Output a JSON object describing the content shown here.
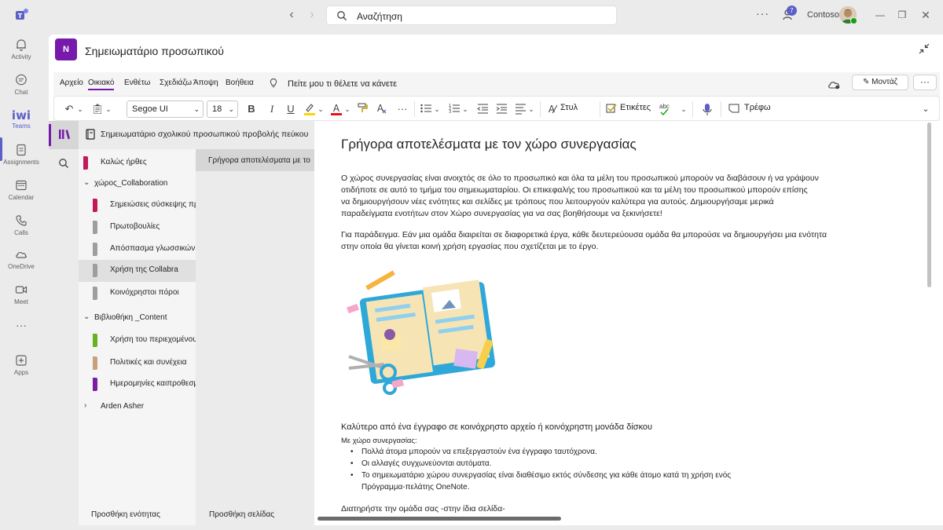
{
  "titlebar": {
    "search_placeholder": "Αναζήτηση",
    "more": "···",
    "notification_count": "7",
    "org_name": "Contoso"
  },
  "rail": {
    "items": [
      {
        "label": "Activity",
        "icon": "bell-icon"
      },
      {
        "label": "Chat",
        "icon": "chat-icon"
      },
      {
        "label": "Teams",
        "icon": "teams-icon"
      },
      {
        "label": "Assignments",
        "icon": "assignments-icon"
      },
      {
        "label": "Calendar",
        "icon": "calendar-icon"
      },
      {
        "label": "Calls",
        "icon": "phone-icon"
      },
      {
        "label": "OneDrive",
        "icon": "cloud-icon"
      },
      {
        "label": "Meet",
        "icon": "video-icon"
      },
      {
        "label": "Apps",
        "icon": "apps-icon"
      }
    ],
    "teams_glyph": "iwi",
    "more": "···"
  },
  "app": {
    "logo_text": "N",
    "title": "Σημειωματάριο προσωπικού"
  },
  "menu": {
    "tabs": [
      "Αρχείο",
      "Οικιακό",
      "Ενθέτω",
      "Σχεδιάζω",
      "Άποψη",
      "Βοήθεια"
    ],
    "tell_me": "Πείτε μου τι θέλετε να κάνετε",
    "edit_label": "Μοντάζ",
    "more": "···"
  },
  "toolbar": {
    "font": "Segoe UI",
    "size": "18",
    "bold": "B",
    "italic": "I",
    "underline": "U",
    "more": "···",
    "styles_label": "Στυλ",
    "tags_label": "Ετικέτες",
    "spell_label": "abc",
    "view_label": "Τρέφω"
  },
  "notebook": {
    "title": "Σημειωματάριο σχολικού προσωπικού προβολής πεύκου",
    "sections": [
      {
        "label": "Καλώς ήρθες",
        "color": "#c2185b",
        "type": "section"
      },
      {
        "label": "χώρος_Collaboration",
        "type": "group"
      },
      {
        "label": "Σημειώσεις σύσκεψης προσωπικού",
        "color": "#c2185b",
        "type": "section"
      },
      {
        "label": "Πρωτοβουλίες",
        "color": "#9e9e9e",
        "type": "section"
      },
      {
        "label": "Απόσπασμα γλωσσικών τεχνών...",
        "color": "#9e9e9e",
        "type": "section"
      },
      {
        "label": "Χρήση της Collabra",
        "color": "#9e9e9e",
        "type": "section",
        "selected": true
      },
      {
        "label": "Κοινόχρηστοι πόροι",
        "color": "#9e9e9e",
        "type": "section"
      },
      {
        "label": "Βιβλιοθήκη _Content",
        "type": "group"
      },
      {
        "label": "Χρήση του περιεχομένου",
        "color": "#6ab023",
        "type": "section"
      },
      {
        "label": "Πολιτικές και συνέχεια",
        "color": "#c8a07c",
        "type": "section"
      },
      {
        "label": "Ημερομηνίες καιπροθεσμίες",
        "color": "#7b1fa2",
        "type": "section"
      },
      {
        "label": "Arden Asher",
        "type": "group-collapsed"
      }
    ],
    "page": "Γρήγορα αποτελέσματα με τον χώρο συνεργασίας",
    "add_section": "Προσθήκη ενότητας",
    "add_page": "Προσθήκη σελίδας"
  },
  "content": {
    "title": "Γρήγορα αποτελέσματα με τον χώρο συνεργασίας",
    "para1": [
      "Ο χώρος συνεργασίας είναι ανοιχτός σε όλο το προσωπικό και όλα τα μέλη του προσωπικού μπορούν να διαβάσουν ή να γράψουν",
      "οτιδήποτε σε αυτό το τμήμα του σημειωματαρίου. Οι επικεφαλής του προσωπικού και τα μέλη του προσωπικού μπορούν επίσης",
      "να δημιουργήσουν νέες ενότητες και σελίδες με τρόπους που λειτουργούν καλύτερα για αυτούς. Δημιουργήσαμε μερικά",
      "παραδείγματα ενοτήτων στον Χώρο συνεργασίας για να σας βοηθήσουμε να ξεκινήσετε!"
    ],
    "para2": [
      "Για παράδειγμα. Εάν μια ομάδα διαιρείται σε διαφορετικά έργα, κάθε δευτερεύουσα ομάδα θα μπορούσε να δημιουργήσει μια ενότητα",
      "στην οποία θα γίνεται κοινή χρήση εργασίας που σχετίζεται με το έργο."
    ],
    "sub_head": "Καλύτερο από ένα έγγραφο σε κοινόχρηστο αρχείο ή κοινόχρηστη μονάδα δίσκου",
    "sub_small": "Με χώρο συνεργασίας:",
    "bullets": [
      "Πολλά άτομα μπορούν να επεξεργαστούν ένα έγγραφο ταυτόχρονα.",
      "Οι αλλαγές συγχωνεύονται αυτόματα.",
      "Το σημειωματάριο χώρου συνεργασίας είναι διαθέσιμο εκτός σύνδεσης για κάθε άτομο κατά τη χρήση ενός",
      "Πρόγραμμα-πελάτης OneNote."
    ],
    "last_line": "Διατηρήστε την ομάδα σας -στην ίδια σελίδα-"
  }
}
